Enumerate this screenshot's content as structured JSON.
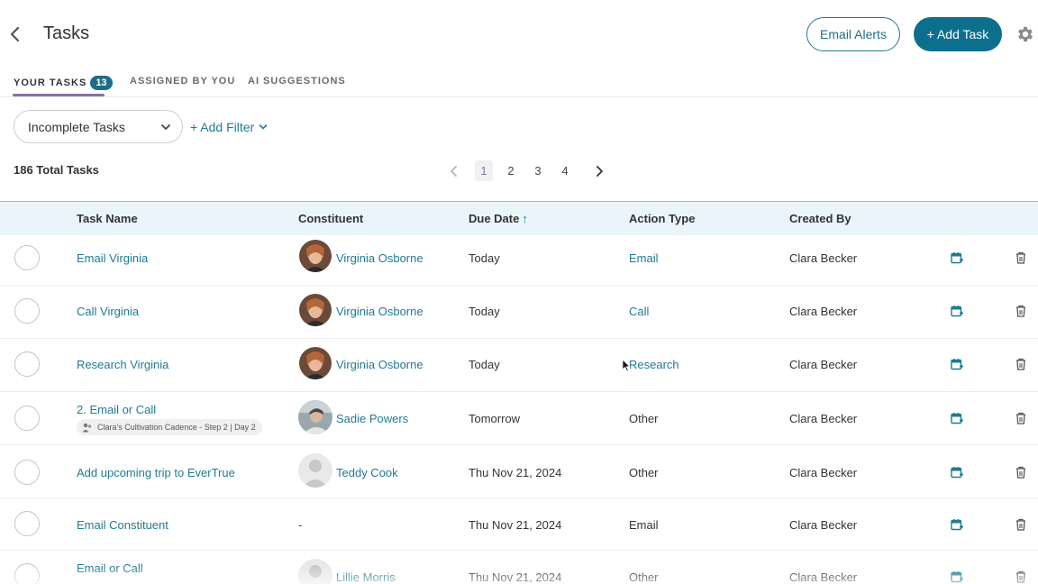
{
  "header": {
    "title": "Tasks",
    "email_alerts_label": "Email Alerts",
    "add_task_label": "+ Add Task"
  },
  "tabs": [
    {
      "label": "YOUR TASKS",
      "count": "13",
      "active": true
    },
    {
      "label": "ASSIGNED BY YOU",
      "active": false
    },
    {
      "label": "AI SUGGESTIONS",
      "active": false
    }
  ],
  "filters": {
    "status_value": "Incomplete Tasks",
    "add_filter_label": "+ Add Filter"
  },
  "summary": {
    "total_label": "186 Total Tasks"
  },
  "pagination": {
    "pages": [
      "1",
      "2",
      "3",
      "4"
    ],
    "current": "1"
  },
  "table": {
    "columns": [
      "Task Name",
      "Constituent",
      "Due Date",
      "Action Type",
      "Created By"
    ],
    "rows": [
      {
        "task": "Email Virginia",
        "constituent": "Virginia Osborne",
        "due": "Today",
        "action": "Email",
        "action_link": true,
        "created_by": "Clara Becker",
        "avatar": "woman"
      },
      {
        "task": "Call Virginia",
        "constituent": "Virginia Osborne",
        "due": "Today",
        "action": "Call",
        "action_link": true,
        "created_by": "Clara Becker",
        "avatar": "woman"
      },
      {
        "task": "Research Virginia",
        "constituent": "Virginia Osborne",
        "due": "Today",
        "action": "Research",
        "action_link": true,
        "created_by": "Clara Becker",
        "avatar": "woman"
      },
      {
        "task": "2. Email or Call",
        "cadence": "Clara's Cultivation Cadence - Step 2 | Day 2",
        "constituent": "Sadie Powers",
        "due": "Tomorrow",
        "action": "Other",
        "action_link": false,
        "created_by": "Clara Becker",
        "avatar": "photo"
      },
      {
        "task": "Add upcoming trip to EverTrue",
        "constituent": "Teddy Cook",
        "due": "Thu Nov 21, 2024",
        "action": "Other",
        "action_link": false,
        "created_by": "Clara Becker",
        "avatar": "placeholder"
      },
      {
        "task": "Email Constituent",
        "constituent": "-",
        "due": "Thu Nov 21, 2024",
        "action": "Email",
        "action_link": false,
        "created_by": "Clara Becker",
        "avatar": "none"
      },
      {
        "task": "Email or Call",
        "constituent": "Lillie Morris",
        "due": "Thu Nov 21, 2024",
        "action": "Other",
        "action_link": false,
        "created_by": "Clara Becker",
        "avatar": "placeholder"
      }
    ]
  },
  "colors": {
    "accent": "#0c6f8e",
    "link": "#1f7b93",
    "tab_underline": "#8a6fa8",
    "header_bg": "#eaf5fa"
  }
}
